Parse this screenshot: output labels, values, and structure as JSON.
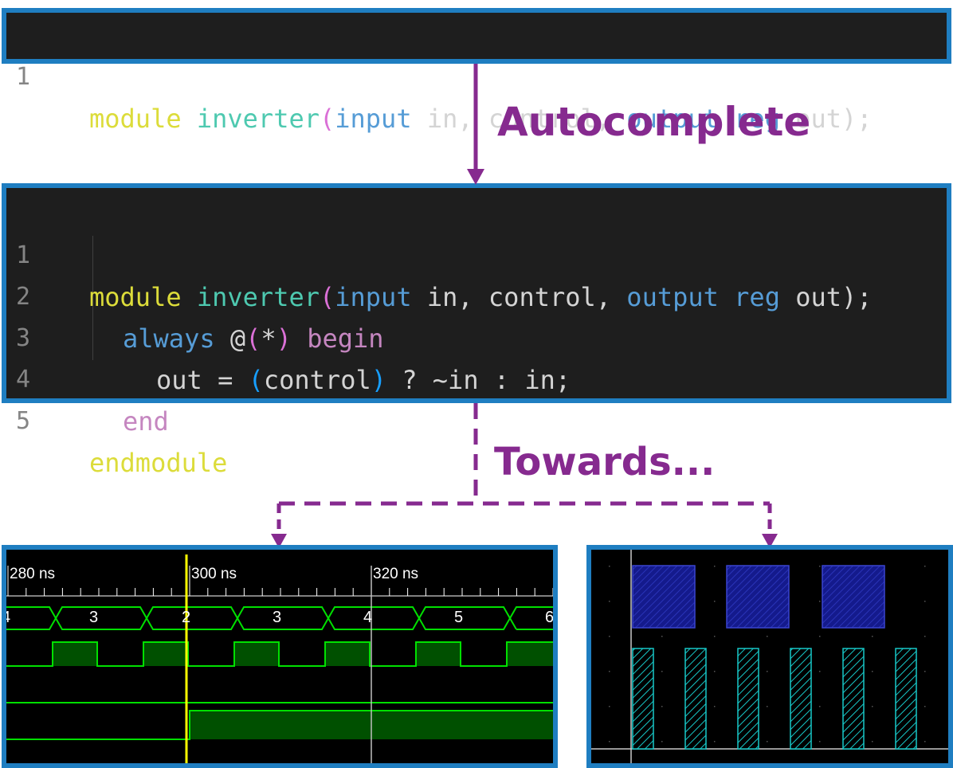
{
  "top_code": {
    "line_number": "1",
    "tokens": [
      "module",
      " ",
      "inverter",
      "(",
      "input",
      " in, control, ",
      "output",
      " ",
      "reg",
      " out);"
    ]
  },
  "autocomplete_label": "Autocomplete",
  "bottom_code": {
    "lines": [
      {
        "n": "1",
        "tokens": [
          "module",
          " ",
          "inverter",
          "(",
          "input",
          " in, control, ",
          "output",
          " ",
          "reg",
          " out);"
        ]
      },
      {
        "n": "2",
        "tokens": [
          "always",
          " @",
          "(",
          "*",
          ")",
          " ",
          "begin"
        ]
      },
      {
        "n": "3",
        "tokens": [
          "out = ",
          "(",
          "control",
          ")",
          " ? ~in : in;"
        ]
      },
      {
        "n": "4",
        "tokens": [
          "end"
        ]
      },
      {
        "n": "5",
        "tokens": [
          "endmodule"
        ]
      }
    ]
  },
  "towards_label": "Towards...",
  "waveform": {
    "time_labels": [
      "280 ns",
      "300 ns",
      "320 ns"
    ],
    "bus_values": [
      "4",
      "3",
      "2",
      "3",
      "4",
      "5",
      "6"
    ],
    "signal_color": "#00e000",
    "cursor_color": "#ffff00"
  },
  "colors": {
    "panel_border": "#1f7ec1",
    "label_purple": "#862a8f",
    "code_bg": "#1e1e1e"
  }
}
